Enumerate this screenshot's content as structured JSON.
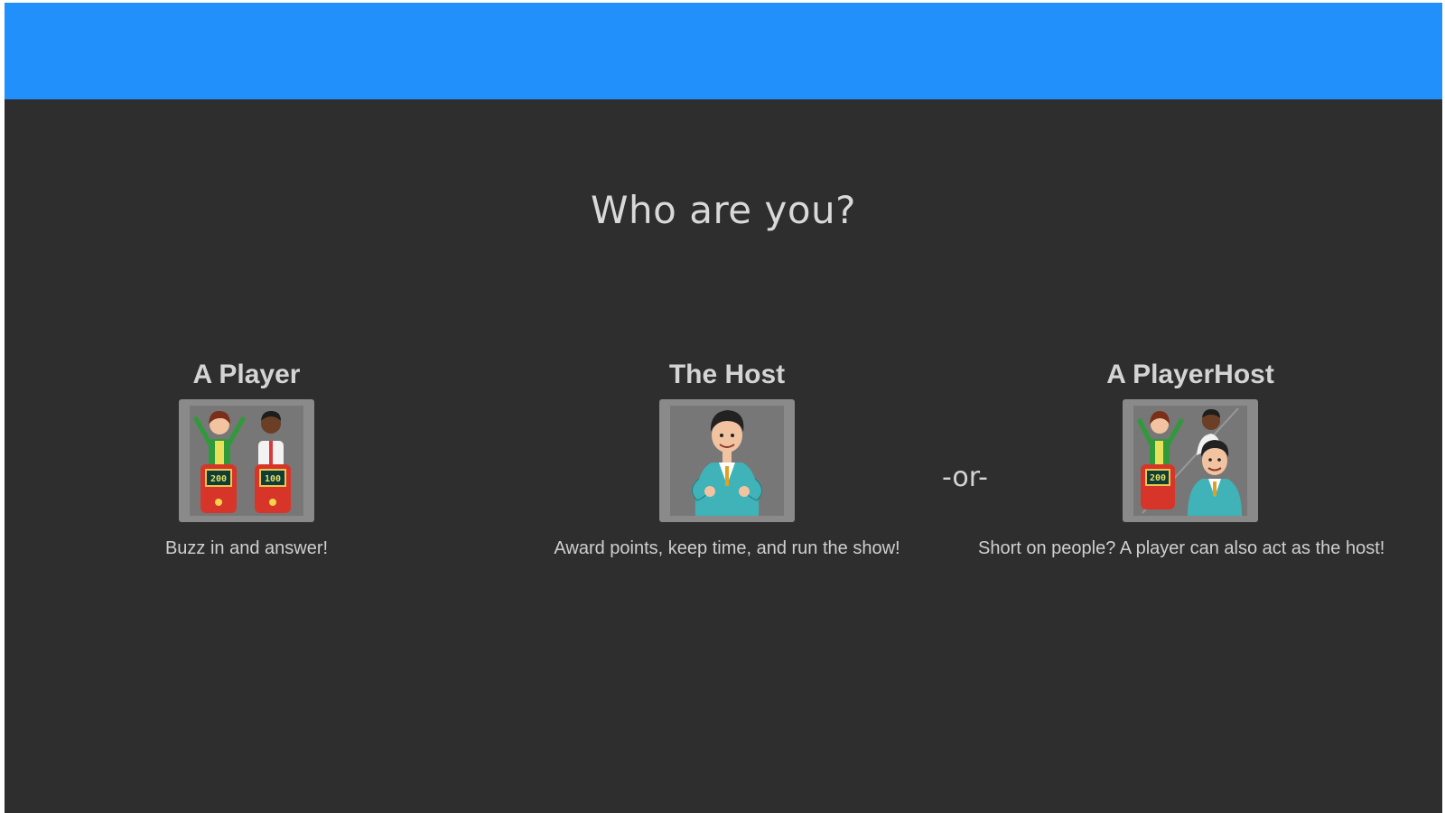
{
  "page": {
    "question": "Who are you?",
    "separator": "-or-"
  },
  "roles": [
    {
      "title": "A Player",
      "description": "Buzz in and answer!",
      "icon": "players-at-podiums-icon",
      "podium_scores": [
        "200",
        "100"
      ]
    },
    {
      "title": "The Host",
      "description": "Award points, keep time, and run the show!",
      "icon": "game-show-host-icon"
    },
    {
      "title": "A PlayerHost",
      "description": "Short on people? A player can also act as the host!",
      "icon": "player-and-host-icon",
      "podium_scores": [
        "200"
      ]
    }
  ],
  "colors": {
    "header": "#2190fb",
    "background": "#2e2e2e",
    "text": "#d4d4d4"
  }
}
